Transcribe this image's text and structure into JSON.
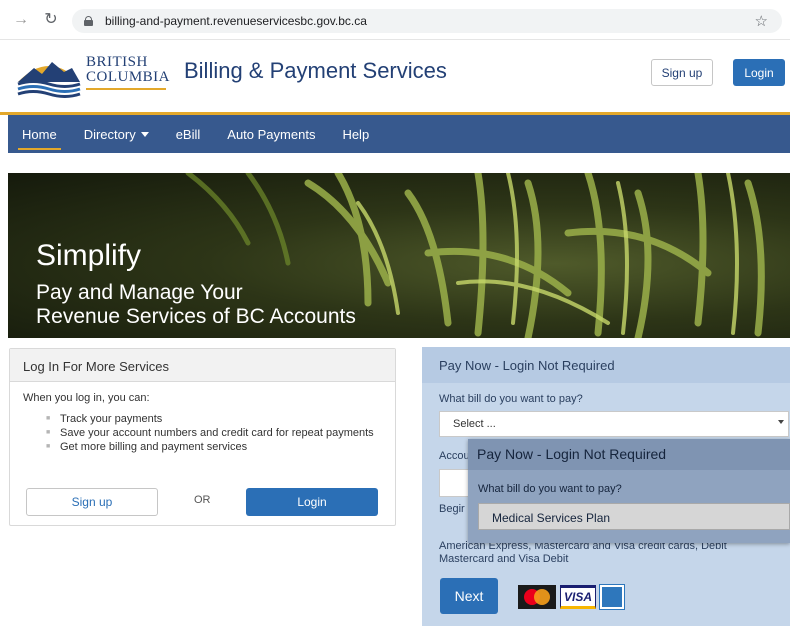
{
  "browser": {
    "url": "billing-and-payment.revenueservicesbc.gov.bc.ca"
  },
  "header": {
    "logo_line1": "BRITISH",
    "logo_line2": "COLUMBIA",
    "title": "Billing & Payment Services",
    "signup_label": "Sign up",
    "login_label": "Login"
  },
  "nav": {
    "items": [
      {
        "label": "Home"
      },
      {
        "label": "Directory"
      },
      {
        "label": "eBill"
      },
      {
        "label": "Auto Payments"
      },
      {
        "label": "Help"
      }
    ]
  },
  "hero": {
    "title": "Simplify",
    "subtitle_line1": "Pay and Manage Your",
    "subtitle_line2": "Revenue Services of BC Accounts"
  },
  "login_panel": {
    "heading": "Log In For More Services",
    "intro": "When you log in, you can:",
    "bullets": [
      "Track your payments",
      "Save your account numbers and credit card for repeat payments",
      "Get more billing and payment services"
    ],
    "signup_label": "Sign up",
    "or_text": "OR",
    "login_label": "Login"
  },
  "pay_panel": {
    "heading": "Pay Now - Login Not Required",
    "question": "What bill do you want to pay?",
    "select_placeholder": "Select ...",
    "account_label": "Accou",
    "begin_text": "Begir",
    "cards_text": "American Express, Mastercard and Visa credit cards, Debit Mastercard and Visa Debit",
    "next_label": "Next",
    "visa_text": "VISA"
  },
  "popup": {
    "heading": "Pay Now - Login Not Required",
    "question": "What bill do you want to pay?",
    "selected_option": "Medical Services Plan"
  },
  "colors": {
    "brand_blue": "#234075",
    "nav_bg": "#37598e",
    "accent_gold": "#e3a82b",
    "button_blue": "#2b6fb6",
    "pay_panel_bg": "#c5d6ea"
  }
}
